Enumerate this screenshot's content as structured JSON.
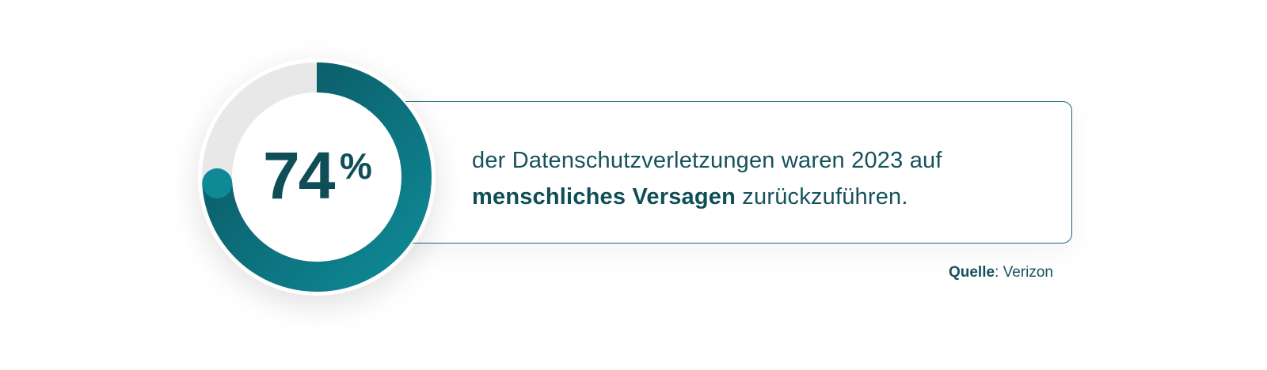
{
  "chart_data": {
    "type": "pie",
    "values": [
      74,
      26
    ],
    "value_label": "74",
    "unit_label": "%",
    "colors": {
      "filled_start": "#0e8a97",
      "filled_end": "#0b535e",
      "track": "#e8e8e8",
      "text": "#0f4d57"
    }
  },
  "statement": {
    "line1": "der Datenschutzverletzungen waren 2023 auf",
    "line2_bold": "menschliches Versagen",
    "line2_rest": " zurückzuführen."
  },
  "source": {
    "label": "Quelle",
    "separator": ": ",
    "value": "Verizon"
  }
}
